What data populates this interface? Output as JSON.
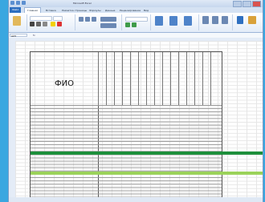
{
  "window": {
    "title": "Microsoft Excel"
  },
  "ribbon_tabs": [
    "Файл",
    "Главная",
    "Вставка",
    "Разметка страницы",
    "Формулы",
    "Данные",
    "Рецензирование",
    "Вид"
  ],
  "formula_bar": {
    "name_box": "A23",
    "fx": "fx"
  },
  "table": {
    "fio_label": "ФИО"
  },
  "colors": {
    "highlight_green": "#1d8f3b",
    "highlight_lime": "#9bd25a",
    "accent": "#2e6fc0"
  }
}
